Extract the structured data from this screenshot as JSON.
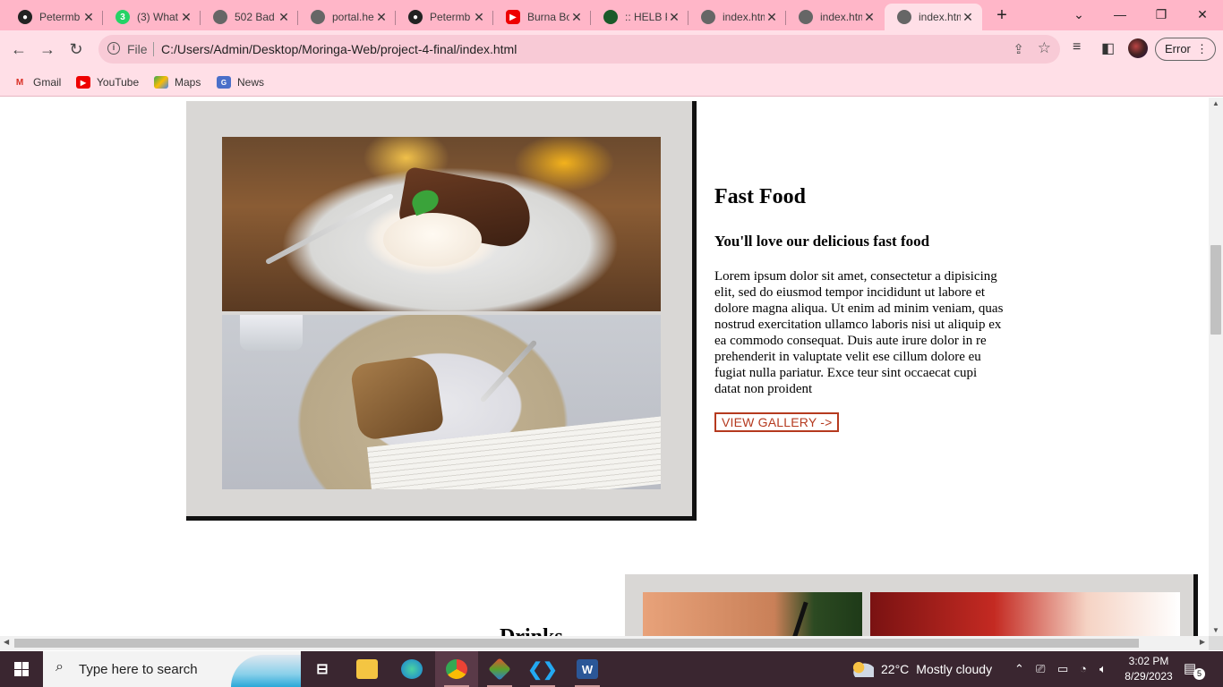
{
  "browser": {
    "tabs": [
      {
        "title": "Petermb",
        "icon": "github-icon"
      },
      {
        "title": "(3) What",
        "icon": "whatsapp-icon"
      },
      {
        "title": "502 Bad",
        "icon": "globe-icon"
      },
      {
        "title": "portal.he",
        "icon": "globe-icon"
      },
      {
        "title": "Petermb",
        "icon": "github-icon"
      },
      {
        "title": "Burna Bo",
        "icon": "youtube-icon"
      },
      {
        "title": ":: HELB P",
        "icon": "helb-icon"
      },
      {
        "title": "index.htm",
        "icon": "globe-icon"
      },
      {
        "title": "index.htm",
        "icon": "globe-icon"
      },
      {
        "title": "index.htm",
        "icon": "globe-icon",
        "active": true
      }
    ],
    "whatsapp_badge": "3",
    "url_scheme": "File",
    "url": "C:/Users/Admin/Desktop/Moringa-Web/project-4-final/index.html",
    "profile_button": "Error",
    "bookmarks": [
      "Gmail",
      "YouTube",
      "Maps",
      "News"
    ]
  },
  "page": {
    "food": {
      "title": "Fast Food",
      "subtitle": "You'll love our delicious fast food",
      "body": "Lorem ipsum dolor sit amet, consectetur a dipisicing elit, sed do eiusmod tempor incididunt ut labore et dolore magna aliqua. Ut enim ad minim veniam, quas nostrud exercitation ullamco laboris nisi ut aliquip ex ea commodo consequat. Duis aute irure dolor in re prehenderit in valuptate velit ese cillum dolore eu fugiat nulla pariatur. Exce teur sint occaecat cupi datat non proident",
      "button": "VIEW GALLERY ->"
    },
    "drinks": {
      "title": "Drinks"
    }
  },
  "taskbar": {
    "search_placeholder": "Type here to search",
    "weather_temp": "22°C",
    "weather_text": "Mostly cloudy",
    "time": "3:02 PM",
    "date": "8/29/2023",
    "notification_count": "5"
  },
  "colors": {
    "tabstrip": "#ffb6c8",
    "toolbar": "#ffdfe7",
    "panel": "#d9d7d5",
    "button_accent": "#b53a1f",
    "taskbar": "#3a2630"
  }
}
